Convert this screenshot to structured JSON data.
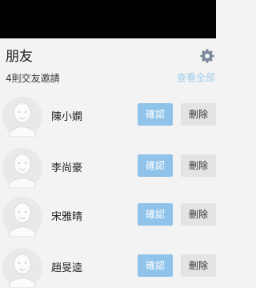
{
  "header": {
    "title": "朋友",
    "settings_icon": "gear-icon"
  },
  "requests": {
    "count_label": "4則交友邀請",
    "see_all_label": "查看全部",
    "items": [
      {
        "name": "陳小嫻",
        "confirm_label": "確認",
        "delete_label": "刪除"
      },
      {
        "name": "李尚豪",
        "confirm_label": "確認",
        "delete_label": "刪除"
      },
      {
        "name": "宋雅晴",
        "confirm_label": "確認",
        "delete_label": "刪除"
      },
      {
        "name": "趙旻逵",
        "confirm_label": "確認",
        "delete_label": "刪除"
      }
    ]
  },
  "colors": {
    "accent": "#8fc3ea",
    "link": "#9fcbea",
    "background": "#f3f3f3",
    "delete_bg": "#e4e4e4"
  }
}
